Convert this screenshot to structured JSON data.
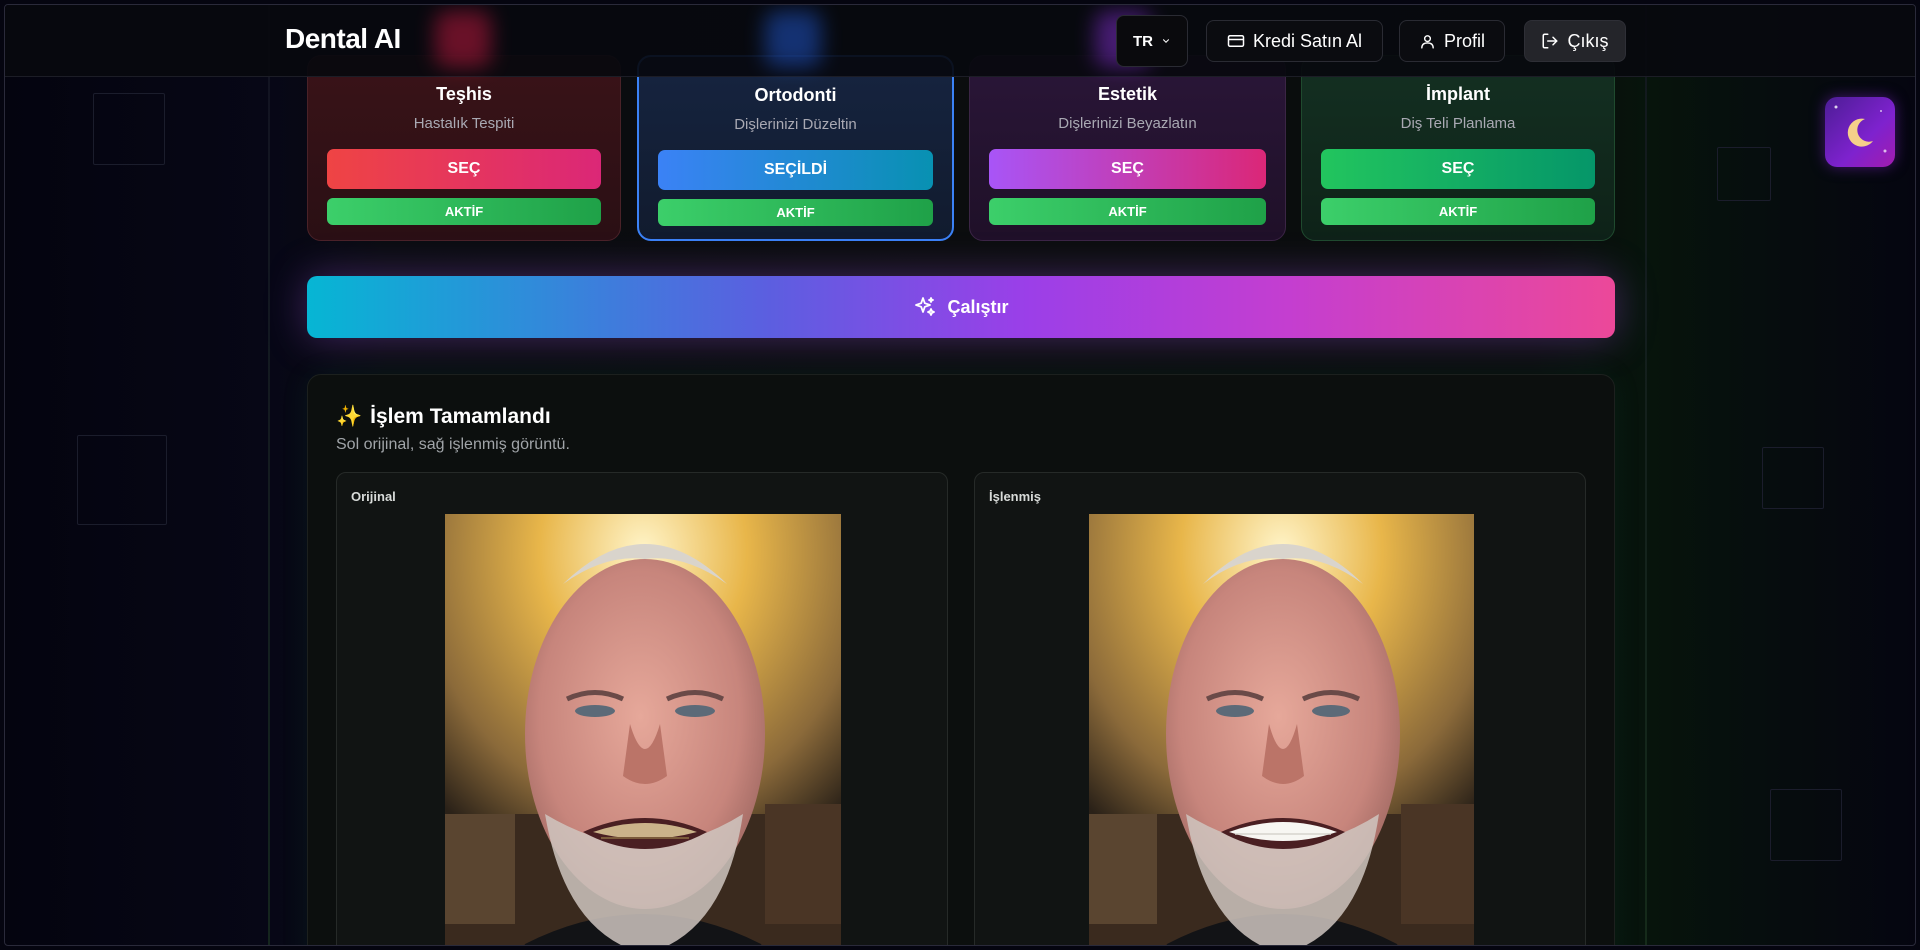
{
  "app": {
    "brand": "Dental AI"
  },
  "topbar": {
    "language": "TR",
    "buy_credits_label": "Kredi Satın Al",
    "profile_label": "Profil",
    "logout_label": "Çıkış"
  },
  "cards": [
    {
      "title": "Teşhis",
      "subtitle": "Hastalık Tespiti",
      "select_label": "SEÇ",
      "status": "AKTİF"
    },
    {
      "title": "Ortodonti",
      "subtitle": "Dişlerinizi Düzeltin",
      "select_label": "SEÇİLDİ",
      "status": "AKTİF"
    },
    {
      "title": "Estetik",
      "subtitle": "Dişlerinizi Beyazlatın",
      "select_label": "SEÇ",
      "status": "AKTİF"
    },
    {
      "title": "İmplant",
      "subtitle": "Diş Teli Planlama",
      "select_label": "SEÇ",
      "status": "AKTİF"
    }
  ],
  "run_button_label": "Çalıştır",
  "result": {
    "title": "İşlem Tamamlandı",
    "title_emoji": "✨",
    "subtitle": "Sol orijinal, sağ işlenmiş görüntü.",
    "original_label": "Orijinal",
    "processed_label": "İşlenmiş"
  },
  "colors": {
    "accent_blue": "#3b82f6",
    "active_green": "#22c55e",
    "run_gradient_start": "#06b6d4",
    "run_gradient_end": "#ec4899"
  },
  "icons": {
    "language_chevron": "chevron-down-icon",
    "credits": "credit-card-icon",
    "profile": "user-icon",
    "logout": "logout-icon",
    "run": "sparkles-icon",
    "theme": "moon-icon"
  }
}
